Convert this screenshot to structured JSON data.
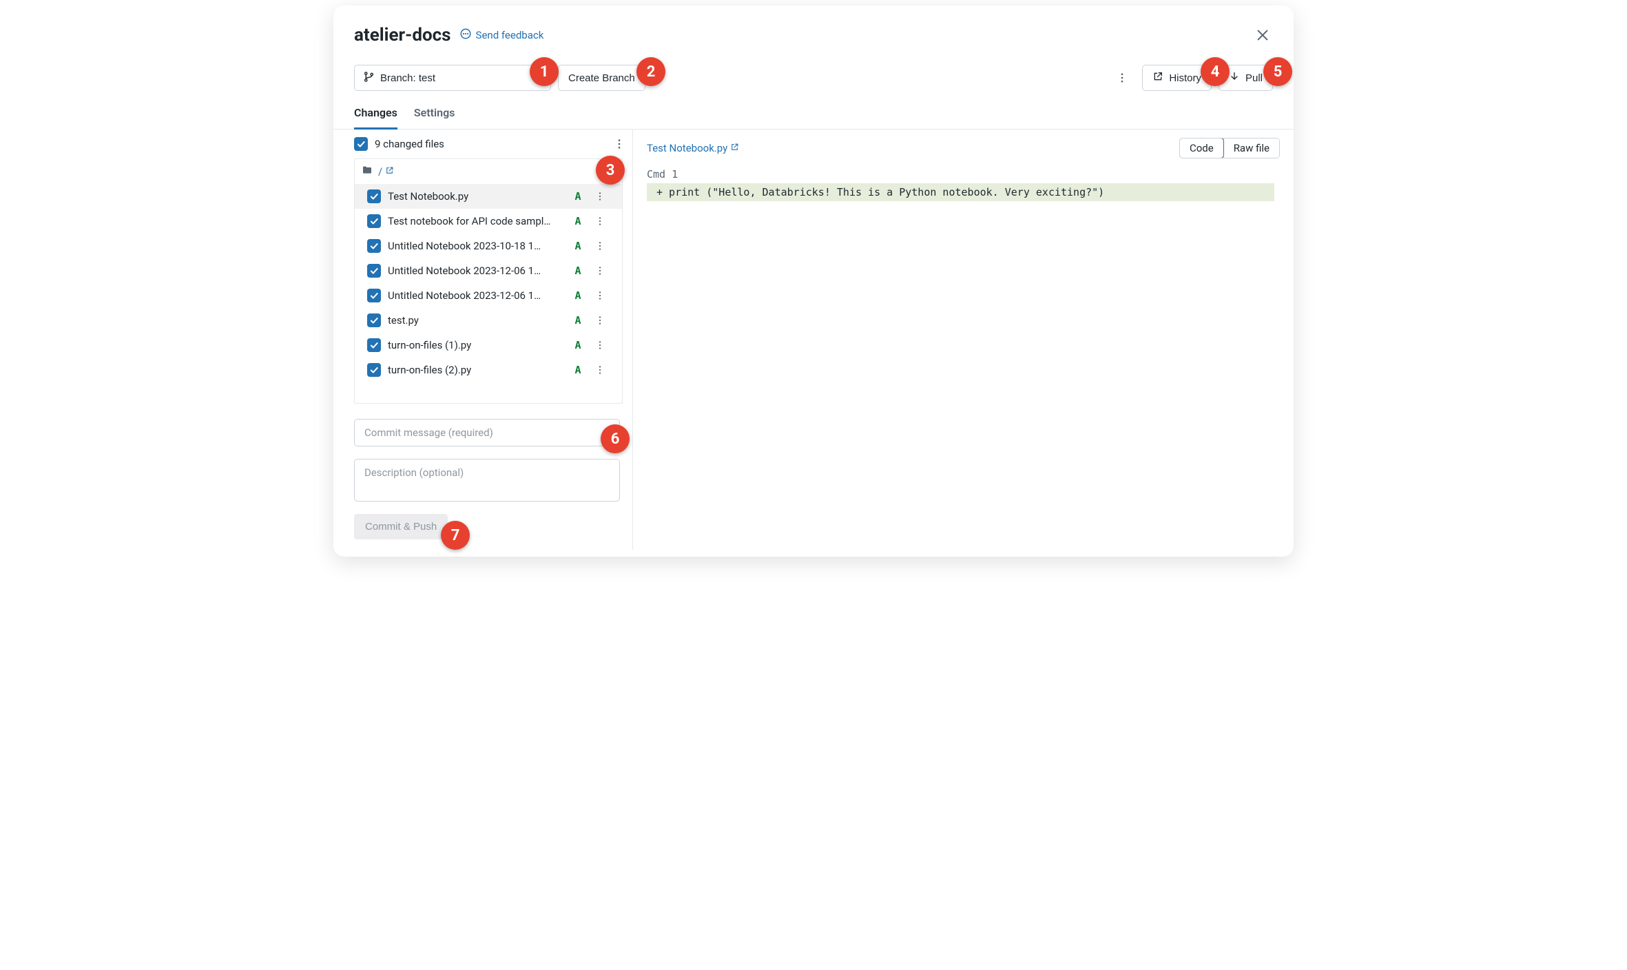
{
  "header": {
    "title": "atelier-docs",
    "feedback_label": "Send feedback"
  },
  "toolbar": {
    "branch_label": "Branch: test",
    "create_branch_label": "Create Branch",
    "history_label": "History",
    "pull_label": "Pull"
  },
  "tabs": {
    "changes": "Changes",
    "settings": "Settings"
  },
  "changes": {
    "count_label": "9 changed files",
    "root_path": "/",
    "files": [
      {
        "name": "Test Notebook.py",
        "status": "A",
        "selected": true
      },
      {
        "name": "Test notebook for API code sampl…",
        "status": "A",
        "selected": false
      },
      {
        "name": "Untitled Notebook 2023-10-18 1…",
        "status": "A",
        "selected": false
      },
      {
        "name": "Untitled Notebook 2023-12-06 1…",
        "status": "A",
        "selected": false
      },
      {
        "name": "Untitled Notebook 2023-12-06 1…",
        "status": "A",
        "selected": false
      },
      {
        "name": "test.py",
        "status": "A",
        "selected": false
      },
      {
        "name": "turn-on-files (1).py",
        "status": "A",
        "selected": false
      },
      {
        "name": "turn-on-files (2).py",
        "status": "A",
        "selected": false
      }
    ]
  },
  "commit": {
    "message_placeholder": "Commit message (required)",
    "description_placeholder": "Description (optional)",
    "button_label": "Commit & Push"
  },
  "diff": {
    "file_title": "Test Notebook.py",
    "view_code": "Code",
    "view_raw": "Raw file",
    "cmd_label": "Cmd 1",
    "added_line": "+ print (\"Hello, Databricks! This is a Python notebook. Very exciting?\")"
  },
  "callouts": [
    "1",
    "2",
    "3",
    "4",
    "5",
    "6",
    "7"
  ]
}
